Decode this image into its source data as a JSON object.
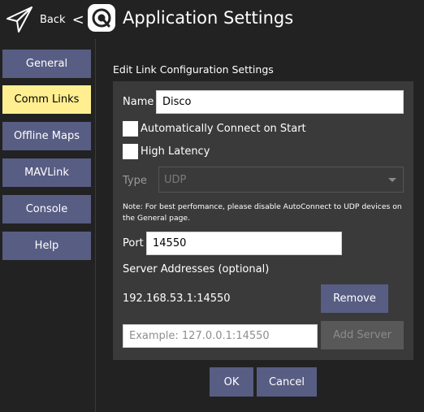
{
  "header": {
    "back_label": "Back",
    "back_symbol": "<",
    "title": "Application Settings",
    "back_icon": "paper-plane-icon",
    "logo_icon": "qgc-logo-icon"
  },
  "sidebar": {
    "items": [
      {
        "label": "General"
      },
      {
        "label": "Comm Links"
      },
      {
        "label": "Offline Maps"
      },
      {
        "label": "MAVLink"
      },
      {
        "label": "Console"
      },
      {
        "label": "Help"
      }
    ],
    "active": "Comm Links"
  },
  "form": {
    "section_title": "Edit Link Configuration Settings",
    "name_label": "Name",
    "name_value": "Disco",
    "auto_connect_label": "Automatically Connect on Start",
    "auto_connect_checked": false,
    "high_latency_label": "High Latency",
    "high_latency_checked": false,
    "type_label": "Type",
    "type_value": "UDP",
    "note": "Note: For best perfomance, please disable AutoConnect to UDP devices on the General page.",
    "port_label": "Port",
    "port_value": "14550",
    "server_addresses_label": "Server Addresses (optional)",
    "server_address": "192.168.53.1:14550",
    "remove_label": "Remove",
    "server_placeholder": "Example: 127.0.0.1:14550",
    "add_server_label": "Add Server"
  },
  "footer": {
    "ok_label": "OK",
    "cancel_label": "Cancel"
  },
  "colors": {
    "background": "#222222",
    "panel": "#3a3a3a",
    "button": "#585d83",
    "active_nav": "#ffef91"
  }
}
